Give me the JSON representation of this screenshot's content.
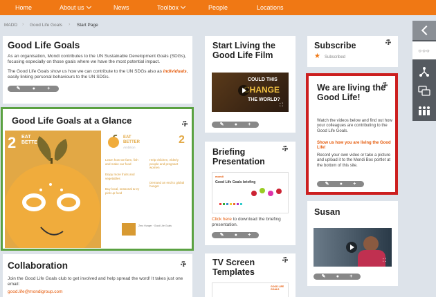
{
  "nav": {
    "items": [
      {
        "label": "Home"
      },
      {
        "label": "About us",
        "dropdown": true
      },
      {
        "label": "News"
      },
      {
        "label": "Toolbox",
        "dropdown": true
      },
      {
        "label": "People"
      },
      {
        "label": "Locations"
      }
    ]
  },
  "breadcrumb": [
    "MADD",
    "Good Life Goals",
    "Start Page"
  ],
  "good_life_goals": {
    "title": "Good Life Goals",
    "p1": "As an organisation, Mondi contributes to the UN Sustainable Development Goals (SDGs), focusing especially on those goals where we have the most potential impact.",
    "p2_start": "The Good Life Goals show us how we can contribute to the UN SDGs also as",
    "p2_em": "individuals",
    "p2_end": ", easily linking personal behaviours to the UN SDGs."
  },
  "glance": {
    "title": "Good Life Goals at a Glance",
    "big_num": "2",
    "poster_heading_1": "EAT",
    "poster_heading_2": "BETTER",
    "right_num": "2",
    "right_heading_1": "EAT",
    "right_heading_2": "BETTER",
    "right_sub": "Ambition",
    "bullets": [
      "Learn how we farm, fish and make our food",
      "Enjoy more fruits and vegetables",
      "Buy local, seasonal & try pick up food",
      "Help children, elderly people and pregnant women",
      "Demand an end to global hunger"
    ],
    "footer_text": "Zero Hunger · Good Life Goals"
  },
  "collaboration": {
    "title": "Collaboration",
    "text": "Join the Good Life Goals club to get involved and help spread the word! It takes just one email:",
    "email": "good.life@mondigroup.com"
  },
  "film": {
    "title": "Start Living the Good Life Film",
    "video_text_1": "COULD THIS",
    "video_text_2": "CHANGE",
    "video_text_3": "THE WORLD?"
  },
  "briefing": {
    "title": "Briefing Presentation",
    "slide_logo": "mondi",
    "slide_title": "Good Life Goals briefing",
    "link": "Click here",
    "text_end": " to download the briefing presentation."
  },
  "tv": {
    "title": "TV Screen Templates",
    "thumb_text": "GOOD LIFE GOALS"
  },
  "subscribe": {
    "title": "Subscribe",
    "status": "Subscribed"
  },
  "living": {
    "title": "We are living the Good Life!",
    "p1": "Watch the videos below and find out how your colleagues are contributing to the Good Life Goals.",
    "highlight": "Show us how you are living the Good Life!",
    "p2": "Record your own video or take a picture and upload it to the Mondi Box portlet at the bottom of this site."
  },
  "susan": {
    "title": "Susan"
  },
  "pill_icons": [
    "✎",
    "●",
    "+"
  ],
  "colors": {
    "orange": "#f07814",
    "green": "#5aa141",
    "red": "#cc1f1f",
    "poster_gold": "#e2a845"
  }
}
